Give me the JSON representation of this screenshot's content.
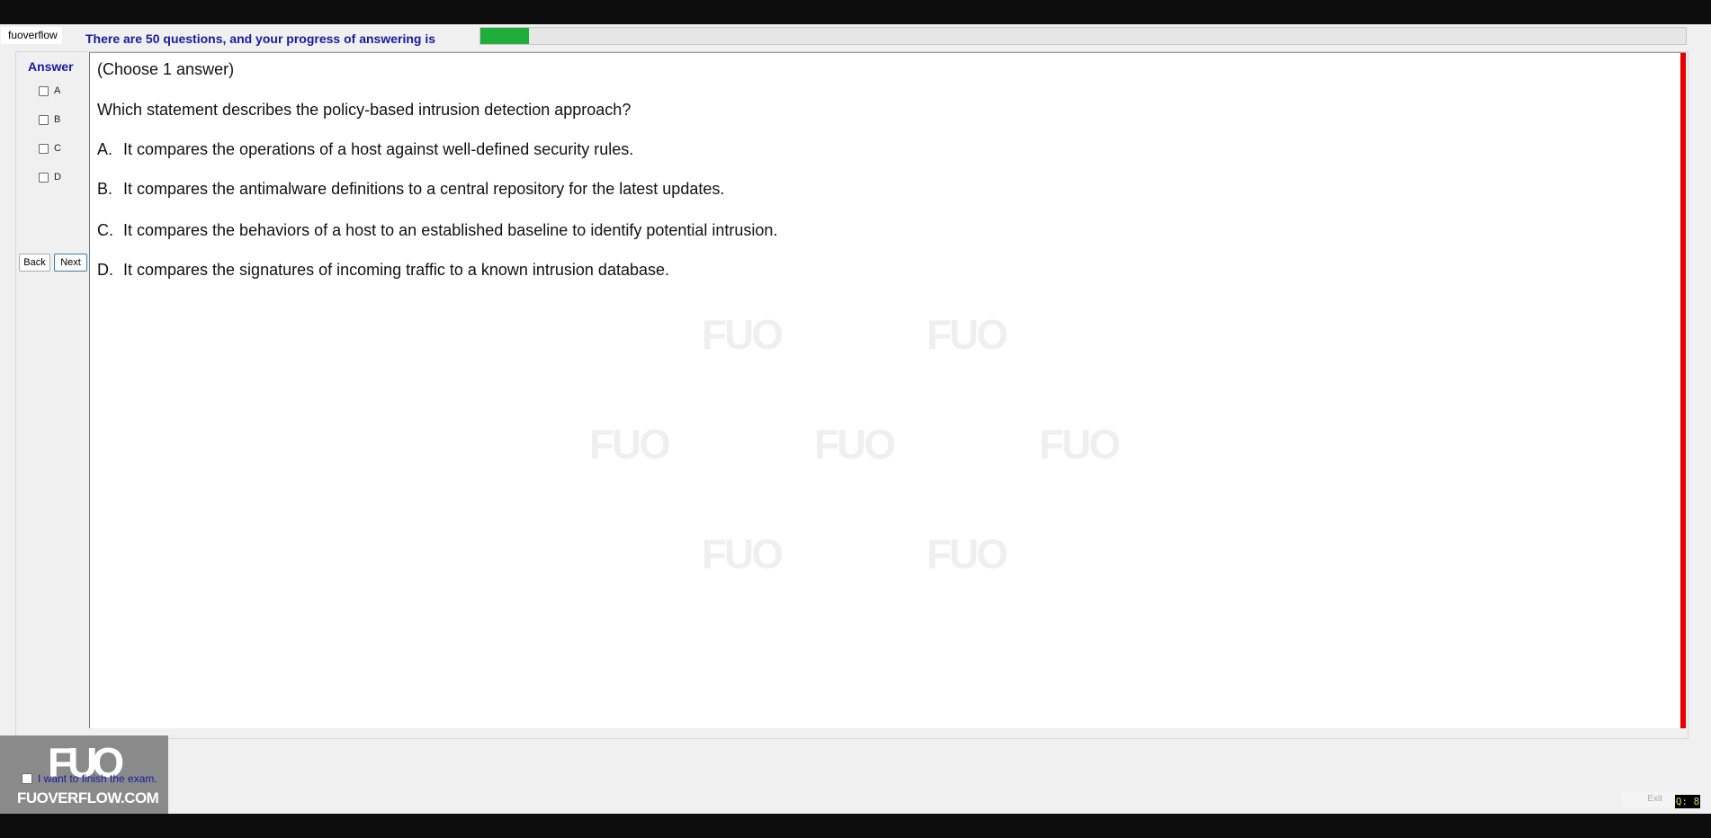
{
  "header": {
    "tab_label": "fuoverflow",
    "progress_text": "There are 50 questions, and your progress of answering is",
    "progress_fraction": 0.04,
    "progress_color": "#1fae3a"
  },
  "sidebar": {
    "answer_title": "Answer",
    "options": [
      "A",
      "B",
      "C",
      "D"
    ],
    "back_label": "Back",
    "next_label": "Next"
  },
  "question": {
    "instruction": "(Choose 1 answer)",
    "stem": "Which statement describes the policy-based intrusion detection approach?",
    "choices": [
      {
        "letter": "A.",
        "text": "It compares the operations of a host against well-defined security rules."
      },
      {
        "letter": "B.",
        "text": "It compares the antimalware definitions to a central repository for the latest updates."
      },
      {
        "letter": "C.",
        "text": "It compares the behaviors of a host to an established baseline to identify potential intrusion."
      },
      {
        "letter": "D.",
        "text": "It compares the signatures of incoming traffic to a known intrusion database."
      }
    ]
  },
  "footer": {
    "logo_text": "FUO",
    "logo_site": "FUOVERFLOW.COM",
    "finish_label": "I want to finish the exam.",
    "exit_label": "Exit",
    "counter": "Q: 8"
  },
  "colors": {
    "accent_text": "#1a1aa0",
    "scroll_marker": "#e60000"
  }
}
